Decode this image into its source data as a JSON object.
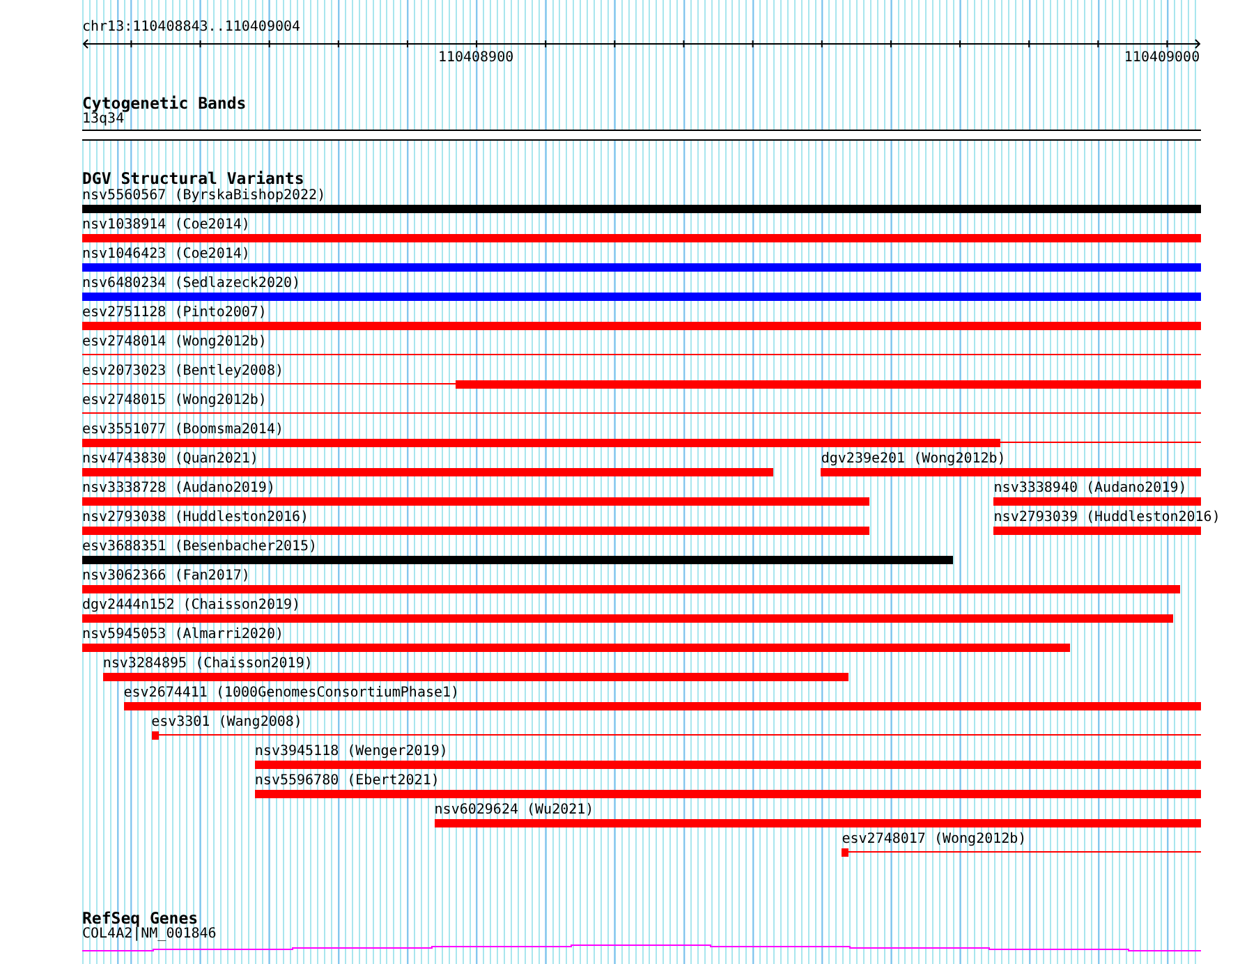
{
  "ruler": {
    "range_label": "chr13:110408843..110409004",
    "ticks": [
      {
        "label": "110408900"
      },
      {
        "label": "110409000"
      }
    ]
  },
  "cytogenetic_bands": {
    "title": "Cytogenetic Bands",
    "band": "13q34"
  },
  "dgv_structural_variants": {
    "title": "DGV Structural Variants",
    "rows": [
      {
        "features": [
          {
            "label": "nsv5560567 (ByrskaBishop2022)",
            "color": "#000000"
          }
        ]
      },
      {
        "features": [
          {
            "label": "nsv1038914 (Coe2014)",
            "color": "#ff0000"
          }
        ]
      },
      {
        "features": [
          {
            "label": "nsv1046423 (Coe2014)",
            "color": "#0000ff"
          }
        ]
      },
      {
        "features": [
          {
            "label": "nsv6480234 (Sedlazeck2020)",
            "color": "#0000ff"
          }
        ]
      },
      {
        "features": [
          {
            "label": "esv2751128 (Pinto2007)",
            "color": "#ff0000"
          }
        ]
      },
      {
        "features": [
          {
            "label": "esv2748014 (Wong2012b)",
            "color": "#ff0000"
          }
        ]
      },
      {
        "features": [
          {
            "label": "esv2073023 (Bentley2008)",
            "color": "#ff0000"
          }
        ]
      },
      {
        "features": [
          {
            "label": "esv2748015 (Wong2012b)",
            "color": "#ff0000"
          }
        ]
      },
      {
        "features": [
          {
            "label": "esv3551077 (Boomsma2014)",
            "color": "#ff0000"
          }
        ]
      },
      {
        "features": [
          {
            "label": "nsv4743830 (Quan2021)",
            "color": "#ff0000"
          },
          {
            "label": "dgv239e201 (Wong2012b)",
            "color": "#ff0000"
          }
        ]
      },
      {
        "features": [
          {
            "label": "nsv3338728 (Audano2019)",
            "color": "#ff0000"
          },
          {
            "label": "nsv3338940 (Audano2019)",
            "color": "#ff0000"
          }
        ]
      },
      {
        "features": [
          {
            "label": "nsv2793038 (Huddleston2016)",
            "color": "#ff0000"
          },
          {
            "label": "nsv2793039 (Huddleston2016)",
            "color": "#ff0000"
          }
        ]
      },
      {
        "features": [
          {
            "label": "esv3688351 (Besenbacher2015)",
            "color": "#000000"
          }
        ]
      },
      {
        "features": [
          {
            "label": "nsv3062366 (Fan2017)",
            "color": "#ff0000"
          }
        ]
      },
      {
        "features": [
          {
            "label": "dgv2444n152 (Chaisson2019)",
            "color": "#ff0000"
          }
        ]
      },
      {
        "features": [
          {
            "label": "nsv5945053 (Almarri2020)",
            "color": "#ff0000"
          }
        ]
      },
      {
        "features": [
          {
            "label": "nsv3284895 (Chaisson2019)",
            "color": "#ff0000"
          }
        ]
      },
      {
        "features": [
          {
            "label": "esv2674411 (1000GenomesConsortiumPhase1)",
            "color": "#ff0000"
          }
        ]
      },
      {
        "features": [
          {
            "label": "esv3301 (Wang2008)",
            "color": "#ff0000"
          }
        ]
      },
      {
        "features": [
          {
            "label": "nsv3945118 (Wenger2019)",
            "color": "#ff0000"
          }
        ]
      },
      {
        "features": [
          {
            "label": "nsv5596780 (Ebert2021)",
            "color": "#ff0000"
          }
        ]
      },
      {
        "features": [
          {
            "label": "nsv6029624 (Wu2021)",
            "color": "#ff0000"
          }
        ]
      },
      {
        "features": [
          {
            "label": "esv2748017 (Wong2012b)",
            "color": "#ff0000"
          }
        ]
      }
    ]
  },
  "refseq_genes": {
    "title": "RefSeq Genes",
    "gene": "COL4A2|NM_001846"
  }
}
